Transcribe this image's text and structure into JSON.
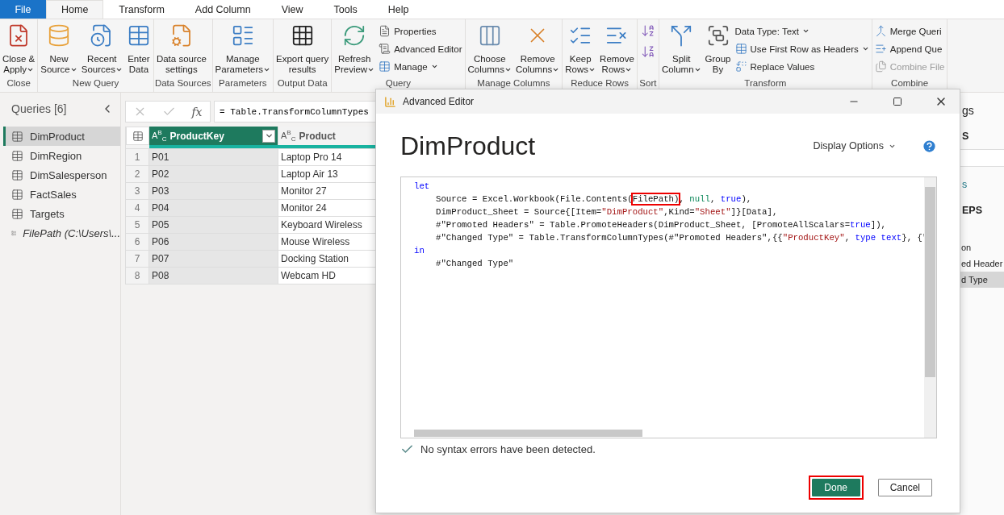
{
  "tabs": [
    {
      "label": "File",
      "kind": "file",
      "selected": false
    },
    {
      "label": "Home",
      "kind": "tab",
      "selected": true
    },
    {
      "label": "Transform",
      "kind": "tab",
      "selected": false
    },
    {
      "label": "Add Column",
      "kind": "tab",
      "selected": false
    },
    {
      "label": "View",
      "kind": "tab",
      "selected": false
    },
    {
      "label": "Tools",
      "kind": "tab",
      "selected": false
    },
    {
      "label": "Help",
      "kind": "tab",
      "selected": false
    }
  ],
  "ribbon": [
    {
      "label": "Close",
      "items": [
        {
          "kind": "large",
          "lines": [
            "Close &",
            "Apply"
          ],
          "dropdown": true
        }
      ]
    },
    {
      "label": "New Query",
      "items": [
        {
          "kind": "large",
          "lines": [
            "New",
            "Source"
          ],
          "dropdown": true
        },
        {
          "kind": "large",
          "lines": [
            "Recent",
            "Sources"
          ],
          "dropdown": true
        },
        {
          "kind": "large",
          "lines": [
            "Enter",
            "Data"
          ],
          "dropdown": false
        }
      ]
    },
    {
      "label": "Data Sources",
      "items": [
        {
          "kind": "large",
          "lines": [
            "Data source",
            "settings"
          ],
          "dropdown": false
        }
      ]
    },
    {
      "label": "Parameters",
      "items": [
        {
          "kind": "large",
          "lines": [
            "Manage",
            "Parameters"
          ],
          "dropdown": true
        }
      ]
    },
    {
      "label": "Output Data",
      "items": [
        {
          "kind": "large",
          "lines": [
            "Export query",
            "results"
          ],
          "dropdown": false
        }
      ]
    },
    {
      "label": "Query",
      "items": [
        {
          "kind": "large",
          "lines": [
            "Refresh",
            "Preview"
          ],
          "dropdown": true
        },
        {
          "kind": "small",
          "label": "Properties",
          "dropdown": false,
          "disabled": false
        },
        {
          "kind": "small",
          "label": "Advanced Editor",
          "dropdown": false,
          "disabled": false
        },
        {
          "kind": "small",
          "label": "Manage",
          "dropdown": true,
          "disabled": false
        }
      ]
    },
    {
      "label": "Manage Columns",
      "items": [
        {
          "kind": "large",
          "lines": [
            "Choose",
            "Columns"
          ],
          "dropdown": true
        },
        {
          "kind": "large",
          "lines": [
            "Remove",
            "Columns"
          ],
          "dropdown": true
        }
      ]
    },
    {
      "label": "Reduce Rows",
      "items": [
        {
          "kind": "large",
          "lines": [
            "Keep",
            "Rows"
          ],
          "dropdown": true
        },
        {
          "kind": "large",
          "lines": [
            "Remove",
            "Rows"
          ],
          "dropdown": true
        }
      ]
    },
    {
      "label": "Sort",
      "items": [
        {
          "kind": "icon"
        },
        {
          "kind": "icon"
        }
      ]
    },
    {
      "label": "Transform",
      "items": [
        {
          "kind": "large",
          "lines": [
            "Split",
            "Column"
          ],
          "dropdown": true
        },
        {
          "kind": "large",
          "lines": [
            "Group",
            "By"
          ],
          "dropdown": false
        },
        {
          "kind": "small",
          "label": "Data Type: Text",
          "dropdown": true,
          "disabled": false
        },
        {
          "kind": "small",
          "label": "Use First Row as Headers",
          "dropdown": true,
          "disabled": false
        },
        {
          "kind": "small",
          "label": "Replace Values",
          "dropdown": false,
          "disabled": false
        }
      ]
    },
    {
      "label": "Combine",
      "items": [
        {
          "kind": "small",
          "label": "Merge Queri",
          "dropdown": false,
          "disabled": false
        },
        {
          "kind": "small",
          "label": "Append Que",
          "dropdown": false,
          "disabled": false
        },
        {
          "kind": "small",
          "label": "Combine File",
          "dropdown": false,
          "disabled": true
        }
      ]
    }
  ],
  "queries": {
    "title": "Queries [6]",
    "items": [
      {
        "name": "DimProduct",
        "kind": "table",
        "selected": true
      },
      {
        "name": "DimRegion",
        "kind": "table",
        "selected": false
      },
      {
        "name": "DimSalesperson",
        "kind": "table",
        "selected": false
      },
      {
        "name": "FactSales",
        "kind": "table",
        "selected": false
      },
      {
        "name": "Targets",
        "kind": "table",
        "selected": false
      },
      {
        "name": "FilePath (C:\\Users\\...",
        "kind": "parameter",
        "selected": false
      }
    ]
  },
  "formula_bar": {
    "fx": "fx",
    "formula": "= Table.TransformColumnTypes"
  },
  "table": {
    "columns": [
      {
        "name": "ProductKey",
        "type": "A$^{B}$$_{C}$",
        "selected": true
      },
      {
        "name": "Product",
        "type": "A$^{B}$$_{C}$",
        "selected": false
      }
    ],
    "rows": [
      {
        "number": "1",
        "cells": [
          "P01",
          "Laptop Pro 14"
        ]
      },
      {
        "number": "2",
        "cells": [
          "P02",
          "Laptop Air 13"
        ]
      },
      {
        "number": "3",
        "cells": [
          "P03",
          "Monitor 27"
        ]
      },
      {
        "number": "4",
        "cells": [
          "P04",
          "Monitor 24"
        ]
      },
      {
        "number": "5",
        "cells": [
          "P05",
          "Keyboard Wireless"
        ]
      },
      {
        "number": "6",
        "cells": [
          "P06",
          "Mouse Wireless"
        ]
      },
      {
        "number": "7",
        "cells": [
          "P07",
          "Docking Station"
        ]
      },
      {
        "number": "8",
        "cells": [
          "P08",
          "Webcam HD"
        ]
      }
    ]
  },
  "settings_pane": {
    "title": "gs",
    "properties_heading": "S",
    "properties_link": "s",
    "steps_heading": "EPS",
    "steps": [
      {
        "name": "on",
        "selected": false
      },
      {
        "name": "ed Header",
        "selected": false
      },
      {
        "name": "d Type",
        "selected": true
      }
    ]
  },
  "dialog": {
    "title": "Advanced Editor",
    "heading": "DimProduct",
    "display_options": "Display Options",
    "code": [
      {
        "indent": false,
        "segments": [
          {
            "text": "let",
            "kind": "keyword",
            "highlighted": false
          }
        ]
      },
      {
        "indent": true,
        "segments": [
          {
            "text": "Source = Excel.Workbook(File.Contents(",
            "kind": "text",
            "highlighted": false
          },
          {
            "text": "FilePath)",
            "kind": "text",
            "highlighted": true
          },
          {
            "text": ", ",
            "kind": "text",
            "highlighted": false
          },
          {
            "text": "null",
            "kind": "literal",
            "highlighted": false
          },
          {
            "text": ", ",
            "kind": "text",
            "highlighted": false
          },
          {
            "text": "true",
            "kind": "keyword",
            "highlighted": false
          },
          {
            "text": "),",
            "kind": "text",
            "highlighted": false
          }
        ]
      },
      {
        "indent": true,
        "segments": [
          {
            "text": "DimProduct_Sheet = Source{[Item=",
            "kind": "text",
            "highlighted": false
          },
          {
            "text": "\"DimProduct\"",
            "kind": "string",
            "highlighted": false
          },
          {
            "text": ",Kind=",
            "kind": "text",
            "highlighted": false
          },
          {
            "text": "\"Sheet\"",
            "kind": "string",
            "highlighted": false
          },
          {
            "text": "]}[Data],",
            "kind": "text",
            "highlighted": false
          }
        ]
      },
      {
        "indent": true,
        "segments": [
          {
            "text": "#\"Promoted Headers\" = Table.PromoteHeaders(DimProduct_Sheet, [PromoteAllScalars=",
            "kind": "text",
            "highlighted": false
          },
          {
            "text": "true",
            "kind": "keyword",
            "highlighted": false
          },
          {
            "text": "]),",
            "kind": "text",
            "highlighted": false
          }
        ]
      },
      {
        "indent": true,
        "segments": [
          {
            "text": "#\"Changed Type\" = Table.TransformColumnTypes(#\"Promoted Headers\",{{",
            "kind": "text",
            "highlighted": false
          },
          {
            "text": "\"ProductKey\"",
            "kind": "string",
            "highlighted": false
          },
          {
            "text": ", ",
            "kind": "text",
            "highlighted": false
          },
          {
            "text": "type text",
            "kind": "keyword",
            "highlighted": false
          },
          {
            "text": "}, {\"",
            "kind": "text",
            "highlighted": false
          }
        ]
      },
      {
        "indent": false,
        "segments": [
          {
            "text": "in",
            "kind": "keyword",
            "highlighted": false
          }
        ]
      },
      {
        "indent": true,
        "segments": [
          {
            "text": "#\"Changed Type\"",
            "kind": "text",
            "highlighted": false
          }
        ]
      }
    ],
    "status": "No syntax errors have been detected.",
    "buttons": [
      {
        "label": "Done",
        "kind": "primary",
        "highlighted": true
      },
      {
        "label": "Cancel",
        "kind": "secondary",
        "highlighted": false
      }
    ]
  }
}
